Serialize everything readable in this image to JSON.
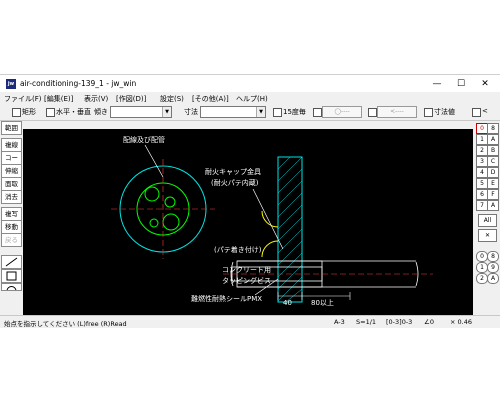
{
  "window": {
    "title": "air-conditioning-139_1 - jw_win",
    "icon_text": "jw"
  },
  "controls": {
    "minimize": "—",
    "maximize": "☐",
    "close": "✕"
  },
  "menu": [
    "ファイル(F)",
    "[編集(E)]",
    "表示(V)",
    "[作図(D)]",
    "設定(S)",
    "[その他(A)]",
    "ヘルプ(H)"
  ],
  "toolbar": {
    "rect": "矩形",
    "hv": "水平・垂直",
    "slope": "傾き",
    "dim": "寸法",
    "every15": "15度毎",
    "btn1": "◯----",
    "btn2": "<----",
    "dimvalue": "寸法値",
    "lt": "<"
  },
  "left_tools": [
    "範囲",
    "複線",
    "コーナー",
    "伸縮",
    "面取",
    "消去",
    "複写",
    "移動",
    "戻る"
  ],
  "right_panel": {
    "row1": [
      "0",
      "8"
    ],
    "row2": [
      "1",
      "A"
    ],
    "row3": [
      "2",
      "B"
    ],
    "row4": [
      "3",
      "C"
    ],
    "row5": [
      "4",
      "D"
    ],
    "row6": [
      "5",
      "E"
    ],
    "row7": [
      "6",
      "F"
    ],
    "row8": [
      "7",
      "A"
    ],
    "all": "All",
    "lower": [
      "0",
      "8",
      "1",
      "9",
      "2",
      "A"
    ]
  },
  "drawing": {
    "label_piping": "配線及び配管",
    "label_cap1": "耐火キャップ金具",
    "label_cap2": "(耐火パテ内蔵)",
    "label_seal": "難燃性耐熱シールPMX",
    "label_putty": "(パテ着き付け)",
    "label_concrete": "コンクリート用",
    "label_screw": "タッピングビス",
    "dim_40": "40",
    "dim_80": "80以上"
  },
  "status": {
    "message": "始点を指示してください (L)free (R)Read",
    "paper": "A-3",
    "scale": "S=1/1",
    "layer": "[0-3]0-3",
    "angle": "∠0",
    "zoom": "× 0.46"
  }
}
